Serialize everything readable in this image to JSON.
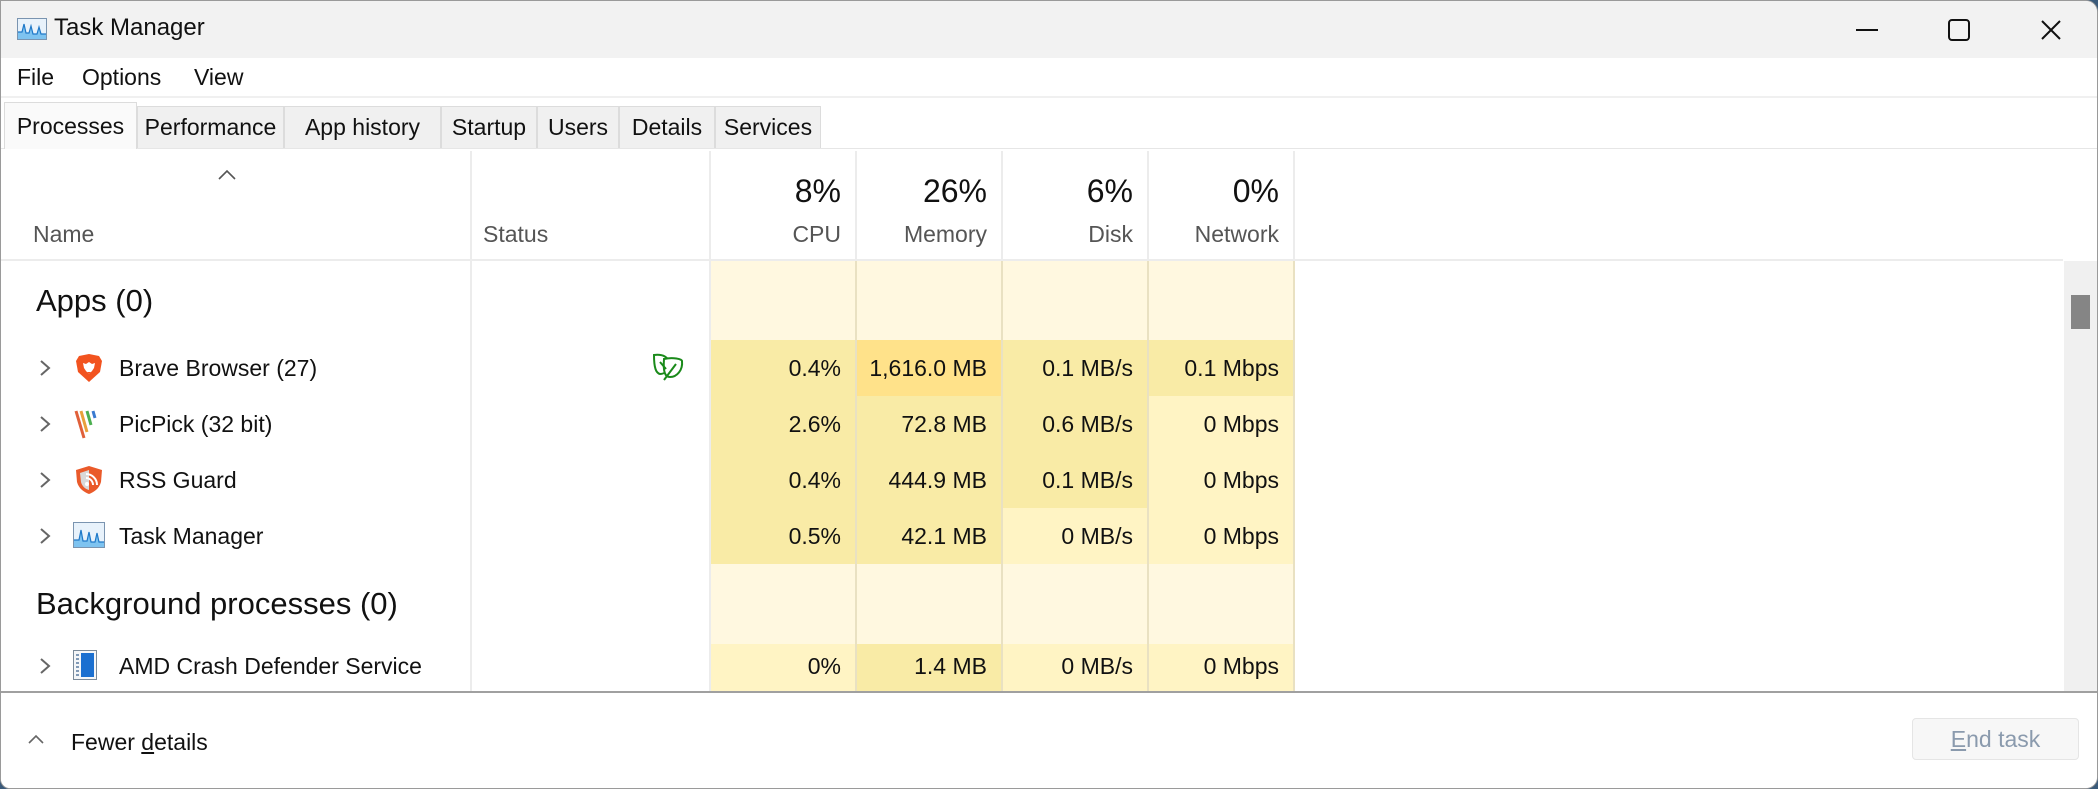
{
  "window": {
    "title": "Task Manager",
    "controls": {
      "minimize": "minimize",
      "maximize": "maximize",
      "close": "close"
    }
  },
  "menu": [
    "File",
    "Options",
    "View"
  ],
  "tabs": [
    {
      "label": "Processes",
      "active": true
    },
    {
      "label": "Performance",
      "active": false
    },
    {
      "label": "App history",
      "active": false
    },
    {
      "label": "Startup",
      "active": false
    },
    {
      "label": "Users",
      "active": false
    },
    {
      "label": "Details",
      "active": false
    },
    {
      "label": "Services",
      "active": false
    }
  ],
  "columns": {
    "name": "Name",
    "status": "Status",
    "cpu": {
      "label": "CPU",
      "total": "8%"
    },
    "memory": {
      "label": "Memory",
      "total": "26%"
    },
    "disk": {
      "label": "Disk",
      "total": "6%"
    },
    "network": {
      "label": "Network",
      "total": "0%"
    }
  },
  "groups": [
    {
      "label": "Apps (0)",
      "rows": [
        {
          "name": "Brave Browser (27)",
          "icon": "brave-icon",
          "status_icon": "efficiency-mode-leaf-icon",
          "cpu": "0.4%",
          "memory": "1,616.0 MB",
          "disk": "0.1 MB/s",
          "network": "0.1 Mbps"
        },
        {
          "name": "PicPick (32 bit)",
          "icon": "picpick-icon",
          "status_icon": "",
          "cpu": "2.6%",
          "memory": "72.8 MB",
          "disk": "0.6 MB/s",
          "network": "0 Mbps"
        },
        {
          "name": "RSS Guard",
          "icon": "rss-guard-icon",
          "status_icon": "",
          "cpu": "0.4%",
          "memory": "444.9 MB",
          "disk": "0.1 MB/s",
          "network": "0 Mbps"
        },
        {
          "name": "Task Manager",
          "icon": "task-manager-icon",
          "status_icon": "",
          "cpu": "0.5%",
          "memory": "42.1 MB",
          "disk": "0 MB/s",
          "network": "0 Mbps"
        }
      ]
    },
    {
      "label": "Background processes (0)",
      "rows": [
        {
          "name": "AMD Crash Defender Service",
          "icon": "service-app-icon",
          "status_icon": "",
          "cpu": "0%",
          "memory": "1.4 MB",
          "disk": "0 MB/s",
          "network": "0 Mbps"
        }
      ]
    }
  ],
  "footer": {
    "fewer_details_pre": "Fewer ",
    "fewer_details_accel": "d",
    "fewer_details_post": "etails",
    "end_task_accel": "E",
    "end_task_post": "nd task",
    "end_task_enabled": false
  },
  "colors": {
    "group_bg": "#fff8e0",
    "cell_low": "#fff4c4",
    "cell_mid": "#f9eba6",
    "cell_high": "#ffe28a",
    "efficiency_green": "#1a8a1a",
    "disabled_text": "#8a9aad"
  }
}
